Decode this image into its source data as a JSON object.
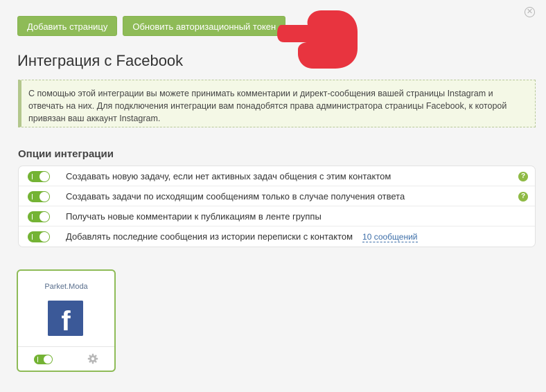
{
  "toolbar": {
    "add_page_label": "Добавить страницу",
    "refresh_token_label": "Обновить авторизационный токен"
  },
  "page_title": "Интеграция с Facebook",
  "info_text": "С помощью этой интеграции вы можете принимать комментарии и директ-сообщения вашей страницы Instagram и отвечать на них. Для подключения интеграции вам понадобятся права администратора страницы Facebook, к которой привязан ваш аккаунт Instagram.",
  "options_title": "Опции интеграции",
  "options": [
    {
      "label": "Создавать новую задачу, если нет активных задач общения с этим контактом",
      "enabled": true,
      "help": "?"
    },
    {
      "label": "Создавать задачи по исходящим сообщениям только в случае получения ответа",
      "enabled": true,
      "help": "?"
    },
    {
      "label": "Получать новые комментарии к публикациям в ленте группы",
      "enabled": true
    },
    {
      "label": "Добавлять последние сообщения из истории переписки с контактом",
      "enabled": true,
      "link": "10 сообщений"
    }
  ],
  "page_card": {
    "name": "Parket.Moda",
    "logo_letter": "f",
    "enabled": true
  },
  "colors": {
    "accent_green": "#8ebb57",
    "toggle_green": "#74b334",
    "facebook_blue": "#3b5998",
    "pointer_red": "#e8343f"
  }
}
